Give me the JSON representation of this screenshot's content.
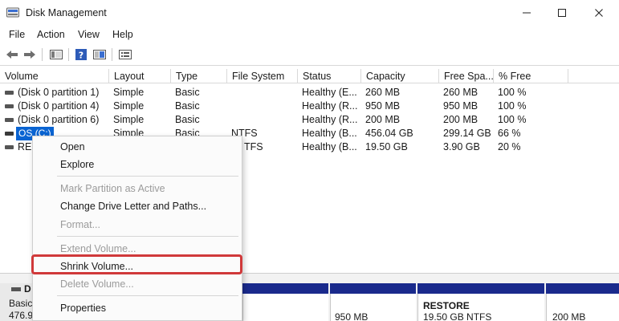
{
  "window": {
    "title": "Disk Management"
  },
  "menu": [
    "File",
    "Action",
    "View",
    "Help"
  ],
  "toolbar_icons": [
    "back-arrow-icon",
    "forward-arrow-icon",
    "console-tree-icon",
    "help-icon",
    "properties-icon",
    "list-view-icon"
  ],
  "columns": [
    "Volume",
    "Layout",
    "Type",
    "File System",
    "Status",
    "Capacity",
    "Free Spa...",
    "% Free"
  ],
  "rows": [
    {
      "volume": "(Disk 0 partition 1)",
      "layout": "Simple",
      "type": "Basic",
      "fs": "",
      "status": "Healthy (E...",
      "capacity": "260 MB",
      "free": "260 MB",
      "pct": "100 %"
    },
    {
      "volume": "(Disk 0 partition 4)",
      "layout": "Simple",
      "type": "Basic",
      "fs": "",
      "status": "Healthy (R...",
      "capacity": "950 MB",
      "free": "950 MB",
      "pct": "100 %"
    },
    {
      "volume": "(Disk 0 partition 6)",
      "layout": "Simple",
      "type": "Basic",
      "fs": "",
      "status": "Healthy (R...",
      "capacity": "200 MB",
      "free": "200 MB",
      "pct": "100 %"
    },
    {
      "volume": "OS (C:)",
      "layout": "Simple",
      "type": "Basic",
      "fs": "NTFS",
      "status": "Healthy (B...",
      "capacity": "456.04 GB",
      "free": "299.14 GB",
      "pct": "66 %"
    },
    {
      "volume": "RES",
      "layout": "",
      "type": "",
      "fs": "TFS",
      "status": "Healthy (B...",
      "capacity": "19.50 GB",
      "free": "3.90 GB",
      "pct": "20 %"
    }
  ],
  "context_menu": {
    "open": "Open",
    "explore": "Explore",
    "mark_active": "Mark Partition as Active",
    "change_letter": "Change Drive Letter and Paths...",
    "format": "Format...",
    "extend": "Extend Volume...",
    "shrink": "Shrink Volume...",
    "delete": "Delete Volume...",
    "properties": "Properties"
  },
  "disk_pane": {
    "disk_title": "D",
    "disk_type": "Basic",
    "disk_size": "476.9",
    "p4_size": "950 MB",
    "restore_name": "RESTORE",
    "restore_size": "19.50 GB NTFS",
    "p6_size": "200 MB"
  },
  "colors": {
    "selection": "#0a64d2",
    "partition_bar": "#1a2a8c",
    "highlight": "#d0393a"
  }
}
